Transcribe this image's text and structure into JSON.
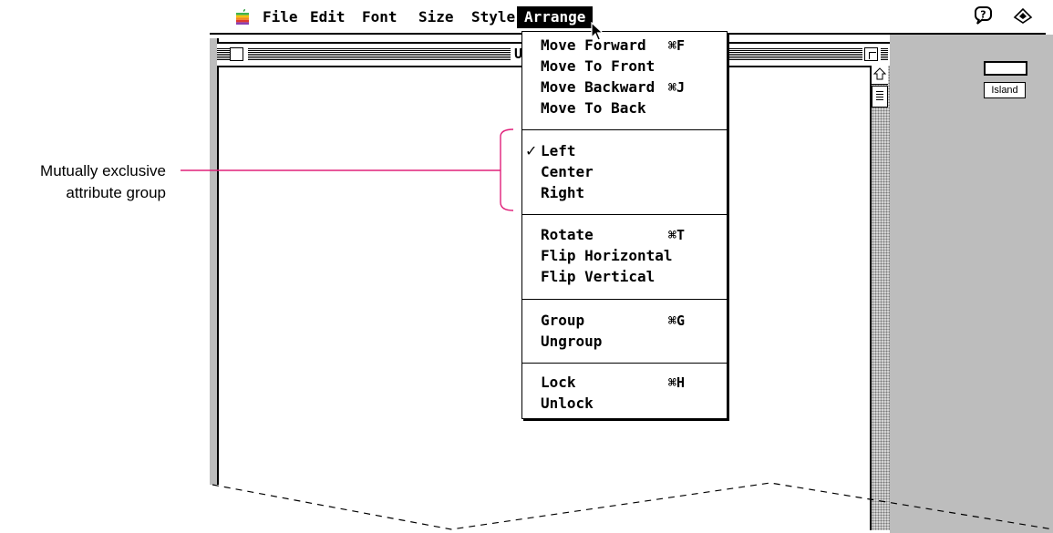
{
  "menubar": {
    "items": [
      "File",
      "Edit",
      "Font",
      "Size",
      "Style",
      "Arrange"
    ]
  },
  "window": {
    "title_partial": "U"
  },
  "desktop": {
    "icon_label": "Island"
  },
  "callout": {
    "line1": "Mutually exclusive",
    "line2": "attribute group"
  },
  "arrange_menu": {
    "groups": [
      [
        {
          "label": "Move Forward",
          "shortcut": "⌘F"
        },
        {
          "label": "Move To Front",
          "shortcut": ""
        },
        {
          "label": "Move Backward",
          "shortcut": "⌘J"
        },
        {
          "label": "Move To Back",
          "shortcut": ""
        }
      ],
      [
        {
          "label": "Left",
          "checked": true
        },
        {
          "label": "Center",
          "checked": false
        },
        {
          "label": "Right",
          "checked": false
        }
      ],
      [
        {
          "label": "Rotate",
          "shortcut": "⌘T"
        },
        {
          "label": "Flip Horizontal",
          "shortcut": ""
        },
        {
          "label": "Flip Vertical",
          "shortcut": ""
        }
      ],
      [
        {
          "label": "Group",
          "shortcut": "⌘G"
        },
        {
          "label": "Ungroup",
          "shortcut": ""
        }
      ],
      [
        {
          "label": "Lock",
          "shortcut": "⌘H"
        },
        {
          "label": "Unlock",
          "shortcut": ""
        }
      ]
    ],
    "check_glyph": "✓"
  },
  "colors": {
    "callout_line": "#e0207a",
    "desktop": "#bdbdbd"
  },
  "icons": [
    "apple-logo-icon",
    "help-balloon-icon",
    "application-menu-icon",
    "cursor-arrow-icon",
    "close-box-icon",
    "zoom-box-icon",
    "scroll-up-arrow-icon"
  ]
}
